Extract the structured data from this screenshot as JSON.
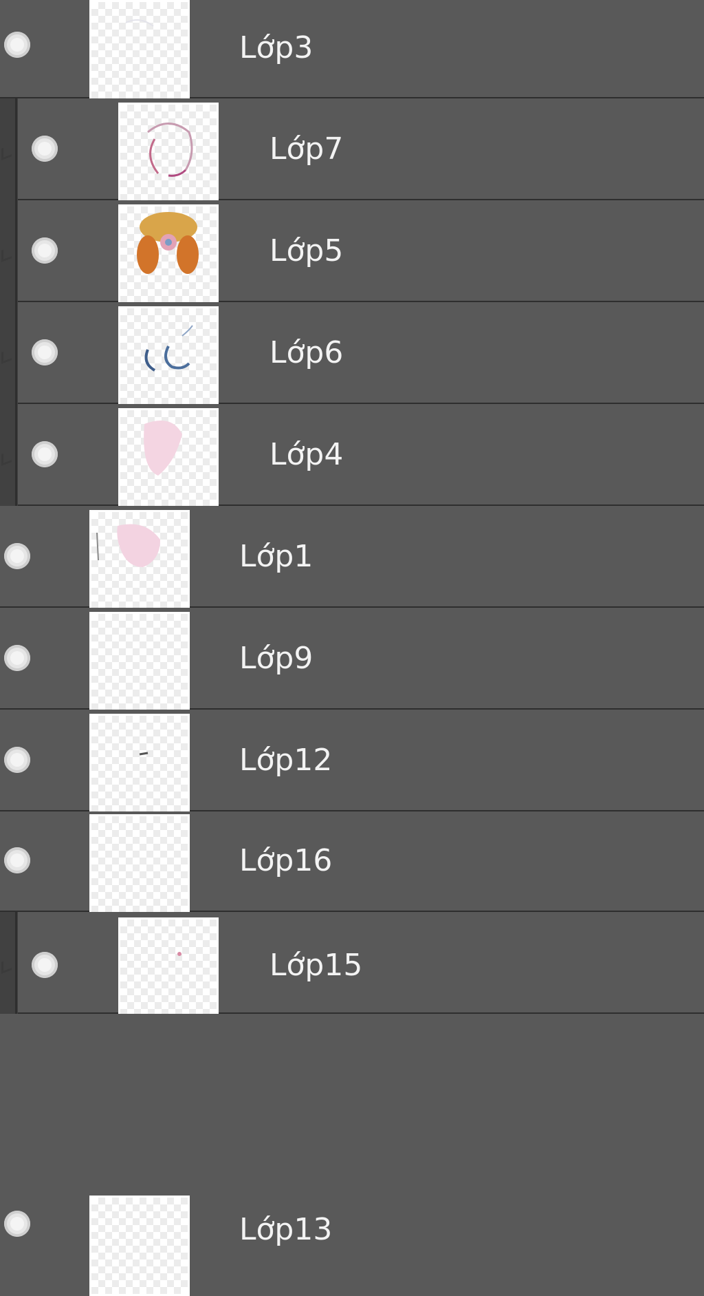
{
  "panel": "layers",
  "layers": [
    {
      "name": "Lớp3",
      "clipped": false,
      "visible": true
    },
    {
      "name": "Lớp7",
      "clipped": true,
      "visible": true
    },
    {
      "name": "Lớp5",
      "clipped": true,
      "visible": true
    },
    {
      "name": "Lớp6",
      "clipped": true,
      "visible": true
    },
    {
      "name": "Lớp4",
      "clipped": true,
      "visible": true
    },
    {
      "name": "Lớp1",
      "clipped": false,
      "visible": true
    },
    {
      "name": "Lớp9",
      "clipped": false,
      "visible": true
    },
    {
      "name": "Lớp12",
      "clipped": false,
      "visible": true
    },
    {
      "name": "Lớp16",
      "clipped": false,
      "visible": true
    },
    {
      "name": "Lớp15",
      "clipped": true,
      "visible": true
    },
    {
      "name": "Lớp13",
      "clipped": false,
      "visible": true
    }
  ],
  "colors": {
    "panel_bg": "#595959",
    "divider": "#2e2e2e",
    "text": "#f3f3f3"
  }
}
